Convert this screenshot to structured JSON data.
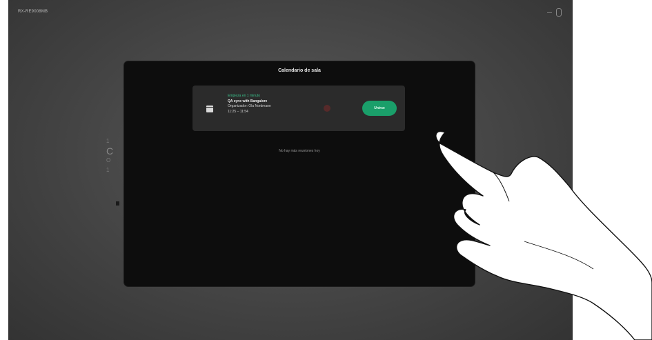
{
  "screen": {
    "top_left_label": "RX-RE9008MB",
    "top_right_time": "—",
    "bg_letters": [
      "1",
      "C",
      "O",
      "1"
    ]
  },
  "dialog": {
    "title": "Calendario de sala",
    "meeting": {
      "starts_in": "Empieza en 1 minuto",
      "title": "QA sync with Bangalore",
      "organizer": "Organizador: Ola Nordmann",
      "time": "11:25 – 11:54",
      "join_label": "Unirse"
    },
    "no_more_text": "No hay más reuniones hoy"
  },
  "colors": {
    "accent_green": "#1a9f6a",
    "starts_green": "#39c08a",
    "dialog_bg": "#0d0d0d",
    "card_bg": "#2b2b2b"
  }
}
